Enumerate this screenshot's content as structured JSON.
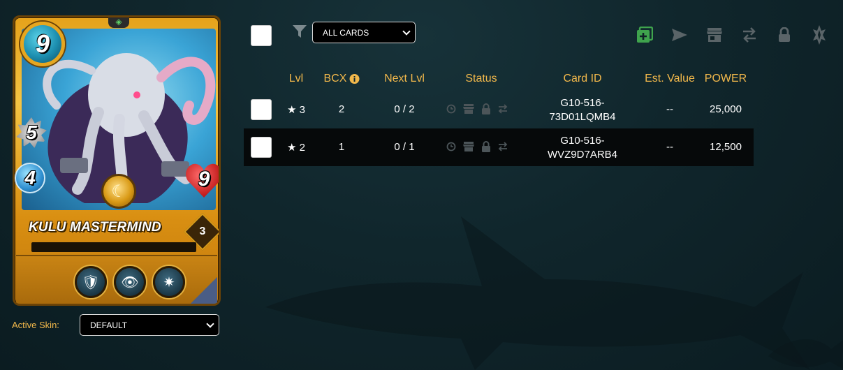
{
  "card": {
    "mana": "9",
    "melee": "5",
    "speed": "4",
    "health": "9",
    "name": "KULU MASTERMIND",
    "level": "3"
  },
  "skin": {
    "label": "Active Skin:",
    "selected": "DEFAULT"
  },
  "filter": {
    "selected": "ALL CARDS"
  },
  "table": {
    "headers": {
      "lvl": "Lvl",
      "bcx": "BCX",
      "next_lvl": "Next Lvl",
      "status": "Status",
      "card_id": "Card ID",
      "est_value": "Est. Value",
      "power": "POWER"
    },
    "rows": [
      {
        "lvl": "★ 3",
        "bcx": "2",
        "next_lvl": "0 / 2",
        "card_id_1": "G10-516-",
        "card_id_2": "73D01LQMB4",
        "est_value": "--",
        "power": "25,000"
      },
      {
        "lvl": "★ 2",
        "bcx": "1",
        "next_lvl": "0 / 1",
        "card_id_1": "G10-516-",
        "card_id_2": "WVZ9D7ARB4",
        "est_value": "--",
        "power": "12,500"
      }
    ]
  },
  "toolbar_icons": [
    "add-to-deck-icon",
    "send-icon",
    "market-icon",
    "transfer-icon",
    "lock-icon",
    "burn-icon"
  ],
  "colors": {
    "accent": "#f2b84b",
    "add_icon": "#3fa34d",
    "disabled_icon": "#5a6468"
  }
}
